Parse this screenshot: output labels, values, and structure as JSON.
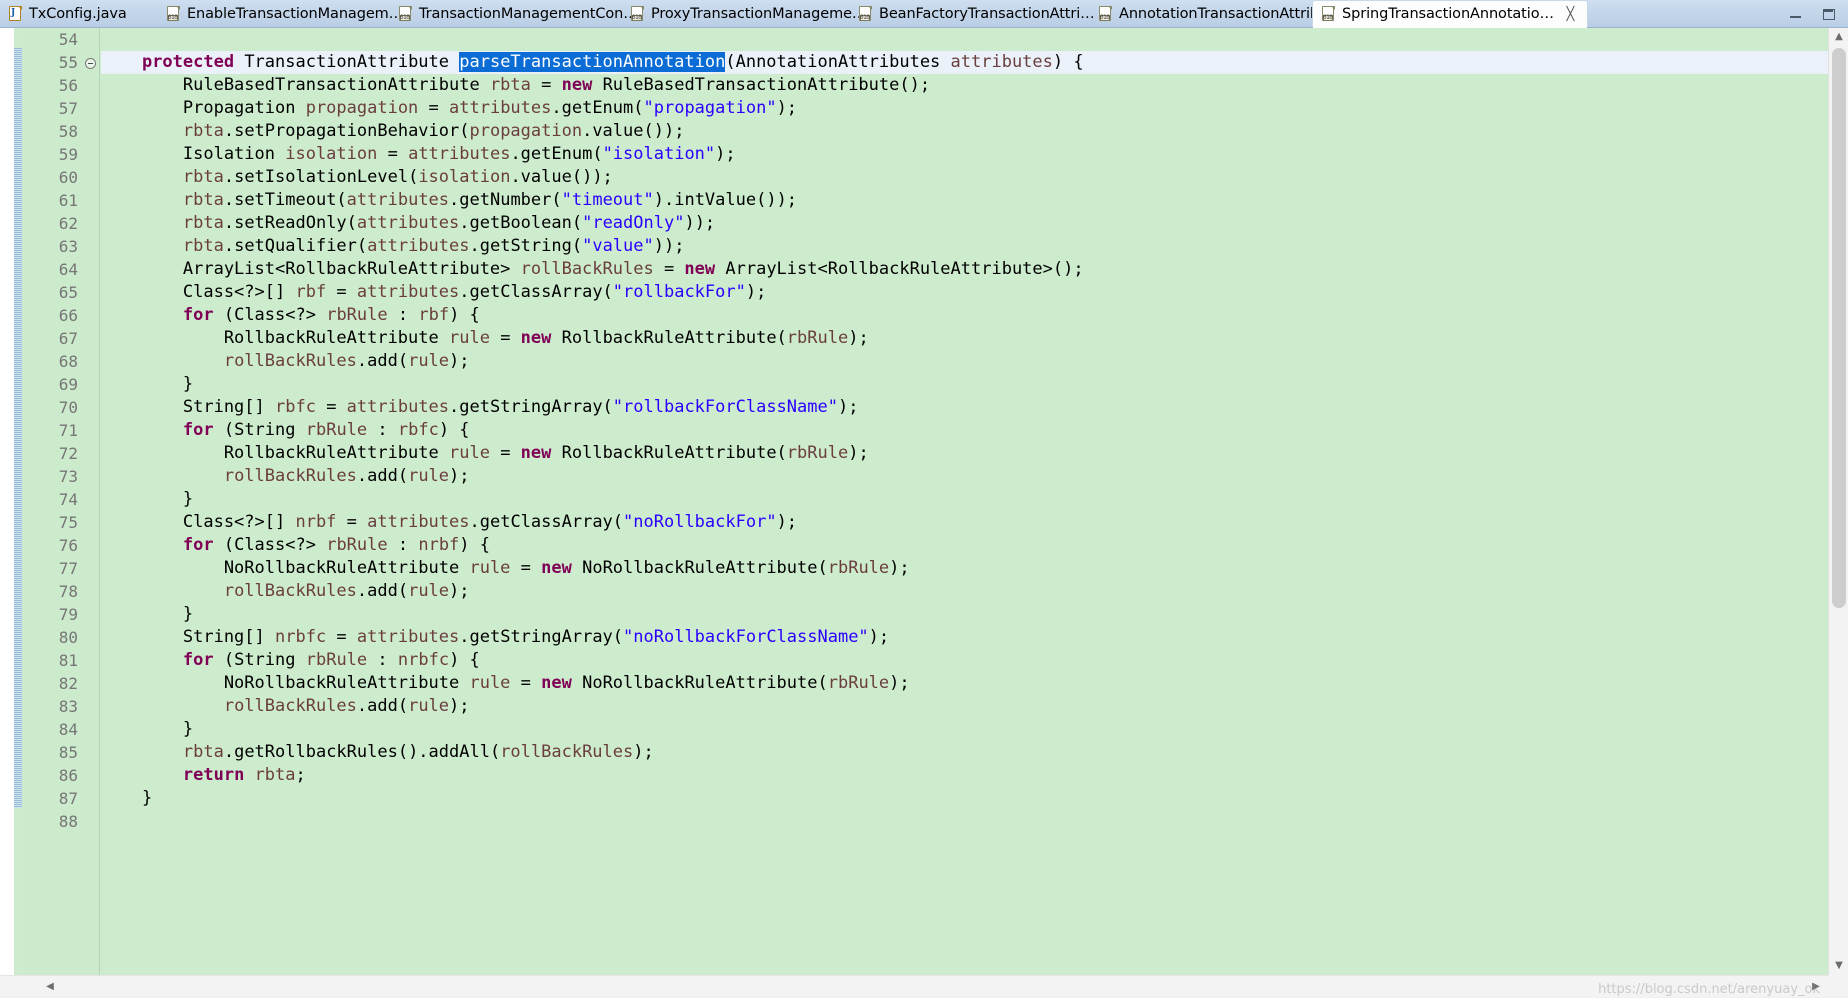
{
  "window": {
    "minimize_label": "minimize",
    "maximize_label": "restore"
  },
  "tabs": [
    {
      "label": "TxConfig.java",
      "icon": "java-file-icon",
      "active": false,
      "closable": false
    },
    {
      "label": "EnableTransactionManagem…",
      "icon": "class-file-icon",
      "active": false,
      "closable": false
    },
    {
      "label": "TransactionManagementCon…",
      "icon": "class-file-icon",
      "active": false,
      "closable": false
    },
    {
      "label": "ProxyTransactionManageme…",
      "icon": "class-file-icon",
      "active": false,
      "closable": false
    },
    {
      "label": "BeanFactoryTransactionAttri…",
      "icon": "class-file-icon",
      "active": false,
      "closable": false
    },
    {
      "label": "AnnotationTransactionAttrib…",
      "icon": "class-file-icon",
      "active": false,
      "closable": false
    },
    {
      "label": "SpringTransactionAnnotatio…",
      "icon": "class-file-icon",
      "active": true,
      "closable": true,
      "close_glyph": "╳"
    }
  ],
  "editor": {
    "first_line_number": 54,
    "selection_text": "parseTransactionAnnotation",
    "colors": {
      "background": "#cdebcd",
      "keyword": "#7f0055",
      "string": "#2a00ff",
      "variable": "#6a3e3e",
      "plain": "#000000",
      "selection_bg": "#0a6cd4",
      "selection_fg": "#ffffff",
      "cursor_line_bg": "#eaf1f8",
      "line_number": "#767676"
    },
    "lines": [
      {
        "num": "54",
        "fold": false,
        "cursor": false,
        "tokens": []
      },
      {
        "num": "55",
        "fold": true,
        "cursor": true,
        "tokens": [
          {
            "t": "    ",
            "c": "pln"
          },
          {
            "t": "protected",
            "c": "kw"
          },
          {
            "t": " TransactionAttribute ",
            "c": "pln"
          },
          {
            "t": "parseTransactionAnnotation",
            "c": "sel"
          },
          {
            "t": "(AnnotationAttributes ",
            "c": "pln"
          },
          {
            "t": "attributes",
            "c": "var"
          },
          {
            "t": ") {",
            "c": "pln"
          }
        ]
      },
      {
        "num": "56",
        "fold": false,
        "cursor": false,
        "tokens": [
          {
            "t": "        RuleBasedTransactionAttribute ",
            "c": "pln"
          },
          {
            "t": "rbta",
            "c": "var"
          },
          {
            "t": " = ",
            "c": "pln"
          },
          {
            "t": "new",
            "c": "kw"
          },
          {
            "t": " RuleBasedTransactionAttribute();",
            "c": "pln"
          }
        ]
      },
      {
        "num": "57",
        "fold": false,
        "cursor": false,
        "tokens": [
          {
            "t": "        Propagation ",
            "c": "pln"
          },
          {
            "t": "propagation",
            "c": "var"
          },
          {
            "t": " = ",
            "c": "pln"
          },
          {
            "t": "attributes",
            "c": "var"
          },
          {
            "t": ".getEnum(",
            "c": "pln"
          },
          {
            "t": "\"propagation\"",
            "c": "str"
          },
          {
            "t": ");",
            "c": "pln"
          }
        ]
      },
      {
        "num": "58",
        "fold": false,
        "cursor": false,
        "tokens": [
          {
            "t": "        ",
            "c": "pln"
          },
          {
            "t": "rbta",
            "c": "var"
          },
          {
            "t": ".setPropagationBehavior(",
            "c": "pln"
          },
          {
            "t": "propagation",
            "c": "var"
          },
          {
            "t": ".value());",
            "c": "pln"
          }
        ]
      },
      {
        "num": "59",
        "fold": false,
        "cursor": false,
        "tokens": [
          {
            "t": "        Isolation ",
            "c": "pln"
          },
          {
            "t": "isolation",
            "c": "var"
          },
          {
            "t": " = ",
            "c": "pln"
          },
          {
            "t": "attributes",
            "c": "var"
          },
          {
            "t": ".getEnum(",
            "c": "pln"
          },
          {
            "t": "\"isolation\"",
            "c": "str"
          },
          {
            "t": ");",
            "c": "pln"
          }
        ]
      },
      {
        "num": "60",
        "fold": false,
        "cursor": false,
        "tokens": [
          {
            "t": "        ",
            "c": "pln"
          },
          {
            "t": "rbta",
            "c": "var"
          },
          {
            "t": ".setIsolationLevel(",
            "c": "pln"
          },
          {
            "t": "isolation",
            "c": "var"
          },
          {
            "t": ".value());",
            "c": "pln"
          }
        ]
      },
      {
        "num": "61",
        "fold": false,
        "cursor": false,
        "tokens": [
          {
            "t": "        ",
            "c": "pln"
          },
          {
            "t": "rbta",
            "c": "var"
          },
          {
            "t": ".setTimeout(",
            "c": "pln"
          },
          {
            "t": "attributes",
            "c": "var"
          },
          {
            "t": ".getNumber(",
            "c": "pln"
          },
          {
            "t": "\"timeout\"",
            "c": "str"
          },
          {
            "t": ").intValue());",
            "c": "pln"
          }
        ]
      },
      {
        "num": "62",
        "fold": false,
        "cursor": false,
        "tokens": [
          {
            "t": "        ",
            "c": "pln"
          },
          {
            "t": "rbta",
            "c": "var"
          },
          {
            "t": ".setReadOnly(",
            "c": "pln"
          },
          {
            "t": "attributes",
            "c": "var"
          },
          {
            "t": ".getBoolean(",
            "c": "pln"
          },
          {
            "t": "\"readOnly\"",
            "c": "str"
          },
          {
            "t": "));",
            "c": "pln"
          }
        ]
      },
      {
        "num": "63",
        "fold": false,
        "cursor": false,
        "tokens": [
          {
            "t": "        ",
            "c": "pln"
          },
          {
            "t": "rbta",
            "c": "var"
          },
          {
            "t": ".setQualifier(",
            "c": "pln"
          },
          {
            "t": "attributes",
            "c": "var"
          },
          {
            "t": ".getString(",
            "c": "pln"
          },
          {
            "t": "\"value\"",
            "c": "str"
          },
          {
            "t": "));",
            "c": "pln"
          }
        ]
      },
      {
        "num": "64",
        "fold": false,
        "cursor": false,
        "tokens": [
          {
            "t": "        ArrayList<RollbackRuleAttribute> ",
            "c": "pln"
          },
          {
            "t": "rollBackRules",
            "c": "var"
          },
          {
            "t": " = ",
            "c": "pln"
          },
          {
            "t": "new",
            "c": "kw"
          },
          {
            "t": " ArrayList<RollbackRuleAttribute>();",
            "c": "pln"
          }
        ]
      },
      {
        "num": "65",
        "fold": false,
        "cursor": false,
        "tokens": [
          {
            "t": "        Class<?>[] ",
            "c": "pln"
          },
          {
            "t": "rbf",
            "c": "var"
          },
          {
            "t": " = ",
            "c": "pln"
          },
          {
            "t": "attributes",
            "c": "var"
          },
          {
            "t": ".getClassArray(",
            "c": "pln"
          },
          {
            "t": "\"rollbackFor\"",
            "c": "str"
          },
          {
            "t": ");",
            "c": "pln"
          }
        ]
      },
      {
        "num": "66",
        "fold": false,
        "cursor": false,
        "tokens": [
          {
            "t": "        ",
            "c": "pln"
          },
          {
            "t": "for",
            "c": "kw"
          },
          {
            "t": " (Class<?> ",
            "c": "pln"
          },
          {
            "t": "rbRule",
            "c": "var"
          },
          {
            "t": " : ",
            "c": "pln"
          },
          {
            "t": "rbf",
            "c": "var"
          },
          {
            "t": ") {",
            "c": "pln"
          }
        ]
      },
      {
        "num": "67",
        "fold": false,
        "cursor": false,
        "tokens": [
          {
            "t": "            RollbackRuleAttribute ",
            "c": "pln"
          },
          {
            "t": "rule",
            "c": "var"
          },
          {
            "t": " = ",
            "c": "pln"
          },
          {
            "t": "new",
            "c": "kw"
          },
          {
            "t": " RollbackRuleAttribute(",
            "c": "pln"
          },
          {
            "t": "rbRule",
            "c": "var"
          },
          {
            "t": ");",
            "c": "pln"
          }
        ]
      },
      {
        "num": "68",
        "fold": false,
        "cursor": false,
        "tokens": [
          {
            "t": "            ",
            "c": "pln"
          },
          {
            "t": "rollBackRules",
            "c": "var"
          },
          {
            "t": ".add(",
            "c": "pln"
          },
          {
            "t": "rule",
            "c": "var"
          },
          {
            "t": ");",
            "c": "pln"
          }
        ]
      },
      {
        "num": "69",
        "fold": false,
        "cursor": false,
        "tokens": [
          {
            "t": "        }",
            "c": "pln"
          }
        ]
      },
      {
        "num": "70",
        "fold": false,
        "cursor": false,
        "tokens": [
          {
            "t": "        String[] ",
            "c": "pln"
          },
          {
            "t": "rbfc",
            "c": "var"
          },
          {
            "t": " = ",
            "c": "pln"
          },
          {
            "t": "attributes",
            "c": "var"
          },
          {
            "t": ".getStringArray(",
            "c": "pln"
          },
          {
            "t": "\"rollbackForClassName\"",
            "c": "str"
          },
          {
            "t": ");",
            "c": "pln"
          }
        ]
      },
      {
        "num": "71",
        "fold": false,
        "cursor": false,
        "tokens": [
          {
            "t": "        ",
            "c": "pln"
          },
          {
            "t": "for",
            "c": "kw"
          },
          {
            "t": " (String ",
            "c": "pln"
          },
          {
            "t": "rbRule",
            "c": "var"
          },
          {
            "t": " : ",
            "c": "pln"
          },
          {
            "t": "rbfc",
            "c": "var"
          },
          {
            "t": ") {",
            "c": "pln"
          }
        ]
      },
      {
        "num": "72",
        "fold": false,
        "cursor": false,
        "tokens": [
          {
            "t": "            RollbackRuleAttribute ",
            "c": "pln"
          },
          {
            "t": "rule",
            "c": "var"
          },
          {
            "t": " = ",
            "c": "pln"
          },
          {
            "t": "new",
            "c": "kw"
          },
          {
            "t": " RollbackRuleAttribute(",
            "c": "pln"
          },
          {
            "t": "rbRule",
            "c": "var"
          },
          {
            "t": ");",
            "c": "pln"
          }
        ]
      },
      {
        "num": "73",
        "fold": false,
        "cursor": false,
        "tokens": [
          {
            "t": "            ",
            "c": "pln"
          },
          {
            "t": "rollBackRules",
            "c": "var"
          },
          {
            "t": ".add(",
            "c": "pln"
          },
          {
            "t": "rule",
            "c": "var"
          },
          {
            "t": ");",
            "c": "pln"
          }
        ]
      },
      {
        "num": "74",
        "fold": false,
        "cursor": false,
        "tokens": [
          {
            "t": "        }",
            "c": "pln"
          }
        ]
      },
      {
        "num": "75",
        "fold": false,
        "cursor": false,
        "tokens": [
          {
            "t": "        Class<?>[] ",
            "c": "pln"
          },
          {
            "t": "nrbf",
            "c": "var"
          },
          {
            "t": " = ",
            "c": "pln"
          },
          {
            "t": "attributes",
            "c": "var"
          },
          {
            "t": ".getClassArray(",
            "c": "pln"
          },
          {
            "t": "\"noRollbackFor\"",
            "c": "str"
          },
          {
            "t": ");",
            "c": "pln"
          }
        ]
      },
      {
        "num": "76",
        "fold": false,
        "cursor": false,
        "tokens": [
          {
            "t": "        ",
            "c": "pln"
          },
          {
            "t": "for",
            "c": "kw"
          },
          {
            "t": " (Class<?> ",
            "c": "pln"
          },
          {
            "t": "rbRule",
            "c": "var"
          },
          {
            "t": " : ",
            "c": "pln"
          },
          {
            "t": "nrbf",
            "c": "var"
          },
          {
            "t": ") {",
            "c": "pln"
          }
        ]
      },
      {
        "num": "77",
        "fold": false,
        "cursor": false,
        "tokens": [
          {
            "t": "            NoRollbackRuleAttribute ",
            "c": "pln"
          },
          {
            "t": "rule",
            "c": "var"
          },
          {
            "t": " = ",
            "c": "pln"
          },
          {
            "t": "new",
            "c": "kw"
          },
          {
            "t": " NoRollbackRuleAttribute(",
            "c": "pln"
          },
          {
            "t": "rbRule",
            "c": "var"
          },
          {
            "t": ");",
            "c": "pln"
          }
        ]
      },
      {
        "num": "78",
        "fold": false,
        "cursor": false,
        "tokens": [
          {
            "t": "            ",
            "c": "pln"
          },
          {
            "t": "rollBackRules",
            "c": "var"
          },
          {
            "t": ".add(",
            "c": "pln"
          },
          {
            "t": "rule",
            "c": "var"
          },
          {
            "t": ");",
            "c": "pln"
          }
        ]
      },
      {
        "num": "79",
        "fold": false,
        "cursor": false,
        "tokens": [
          {
            "t": "        }",
            "c": "pln"
          }
        ]
      },
      {
        "num": "80",
        "fold": false,
        "cursor": false,
        "tokens": [
          {
            "t": "        String[] ",
            "c": "pln"
          },
          {
            "t": "nrbfc",
            "c": "var"
          },
          {
            "t": " = ",
            "c": "pln"
          },
          {
            "t": "attributes",
            "c": "var"
          },
          {
            "t": ".getStringArray(",
            "c": "pln"
          },
          {
            "t": "\"noRollbackForClassName\"",
            "c": "str"
          },
          {
            "t": ");",
            "c": "pln"
          }
        ]
      },
      {
        "num": "81",
        "fold": false,
        "cursor": false,
        "tokens": [
          {
            "t": "        ",
            "c": "pln"
          },
          {
            "t": "for",
            "c": "kw"
          },
          {
            "t": " (String ",
            "c": "pln"
          },
          {
            "t": "rbRule",
            "c": "var"
          },
          {
            "t": " : ",
            "c": "pln"
          },
          {
            "t": "nrbfc",
            "c": "var"
          },
          {
            "t": ") {",
            "c": "pln"
          }
        ]
      },
      {
        "num": "82",
        "fold": false,
        "cursor": false,
        "tokens": [
          {
            "t": "            NoRollbackRuleAttribute ",
            "c": "pln"
          },
          {
            "t": "rule",
            "c": "var"
          },
          {
            "t": " = ",
            "c": "pln"
          },
          {
            "t": "new",
            "c": "kw"
          },
          {
            "t": " NoRollbackRuleAttribute(",
            "c": "pln"
          },
          {
            "t": "rbRule",
            "c": "var"
          },
          {
            "t": ");",
            "c": "pln"
          }
        ]
      },
      {
        "num": "83",
        "fold": false,
        "cursor": false,
        "tokens": [
          {
            "t": "            ",
            "c": "pln"
          },
          {
            "t": "rollBackRules",
            "c": "var"
          },
          {
            "t": ".add(",
            "c": "pln"
          },
          {
            "t": "rule",
            "c": "var"
          },
          {
            "t": ");",
            "c": "pln"
          }
        ]
      },
      {
        "num": "84",
        "fold": false,
        "cursor": false,
        "tokens": [
          {
            "t": "        }",
            "c": "pln"
          }
        ]
      },
      {
        "num": "85",
        "fold": false,
        "cursor": false,
        "tokens": [
          {
            "t": "        ",
            "c": "pln"
          },
          {
            "t": "rbta",
            "c": "var"
          },
          {
            "t": ".getRollbackRules().addAll(",
            "c": "pln"
          },
          {
            "t": "rollBackRules",
            "c": "var"
          },
          {
            "t": ");",
            "c": "pln"
          }
        ]
      },
      {
        "num": "86",
        "fold": false,
        "cursor": false,
        "tokens": [
          {
            "t": "        ",
            "c": "pln"
          },
          {
            "t": "return",
            "c": "kw"
          },
          {
            "t": " ",
            "c": "pln"
          },
          {
            "t": "rbta",
            "c": "var"
          },
          {
            "t": ";",
            "c": "pln"
          }
        ]
      },
      {
        "num": "87",
        "fold": false,
        "cursor": false,
        "tokens": [
          {
            "t": "    }",
            "c": "pln"
          }
        ]
      },
      {
        "num": "88",
        "fold": false,
        "cursor": false,
        "tokens": []
      }
    ]
  },
  "scrollbars": {
    "up_arrow": "▲",
    "down_arrow": "▼",
    "left_arrow": "◀",
    "right_arrow": "▶"
  },
  "watermark": "https://blog.csdn.net/arenyuay_ok"
}
